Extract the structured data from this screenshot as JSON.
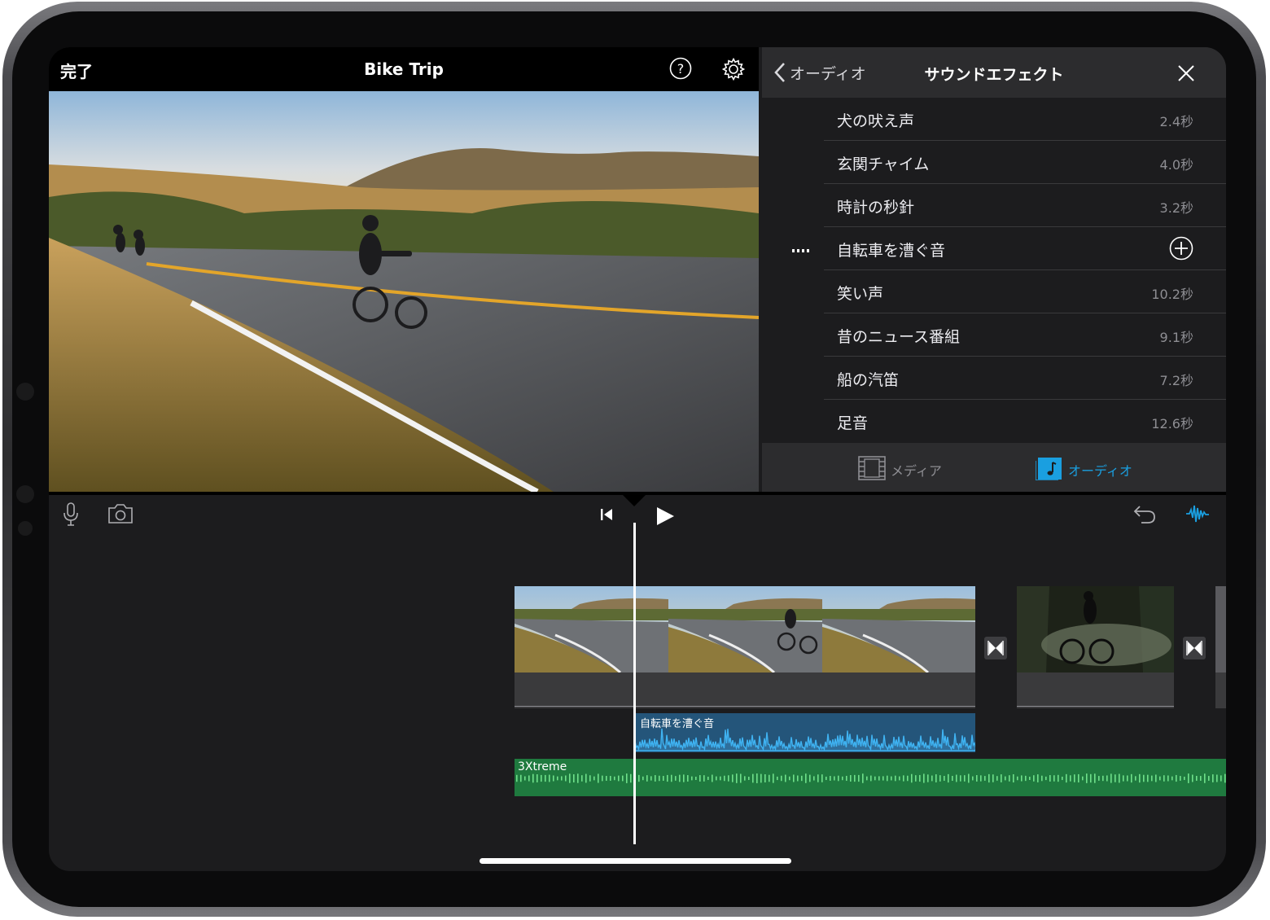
{
  "topbar": {
    "done_label": "完了",
    "project_title": "Bike Trip"
  },
  "panel": {
    "back_label": "オーディオ",
    "title": "サウンドエフェクト",
    "sound_effects": [
      {
        "name": "犬の吠え声",
        "duration": "2.4秒"
      },
      {
        "name": "玄関チャイム",
        "duration": "4.0秒"
      },
      {
        "name": "時計の秒針",
        "duration": "3.2秒"
      },
      {
        "name": "自転車を漕ぐ音",
        "duration": "",
        "playing": true
      },
      {
        "name": "笑い声",
        "duration": "10.2秒"
      },
      {
        "name": "昔のニュース番組",
        "duration": "9.1秒"
      },
      {
        "name": "船の汽笛",
        "duration": "7.2秒"
      },
      {
        "name": "足音",
        "duration": "12.6秒"
      }
    ],
    "tabs": [
      {
        "label": "メディア",
        "icon": "film-icon",
        "selected": false
      },
      {
        "label": "オーディオ",
        "icon": "music-note-icon",
        "selected": true
      }
    ]
  },
  "timeline": {
    "sfx_clip_label": "自転車を漕ぐ音",
    "music_clip_label": "3Xtreme"
  },
  "colors": {
    "accent": "#1a9fe0",
    "sfx_clip": "#24557a",
    "sfx_wave": "#3fb3f2",
    "music_clip": "#1f7a3f",
    "music_wave": "#6fe08a"
  }
}
